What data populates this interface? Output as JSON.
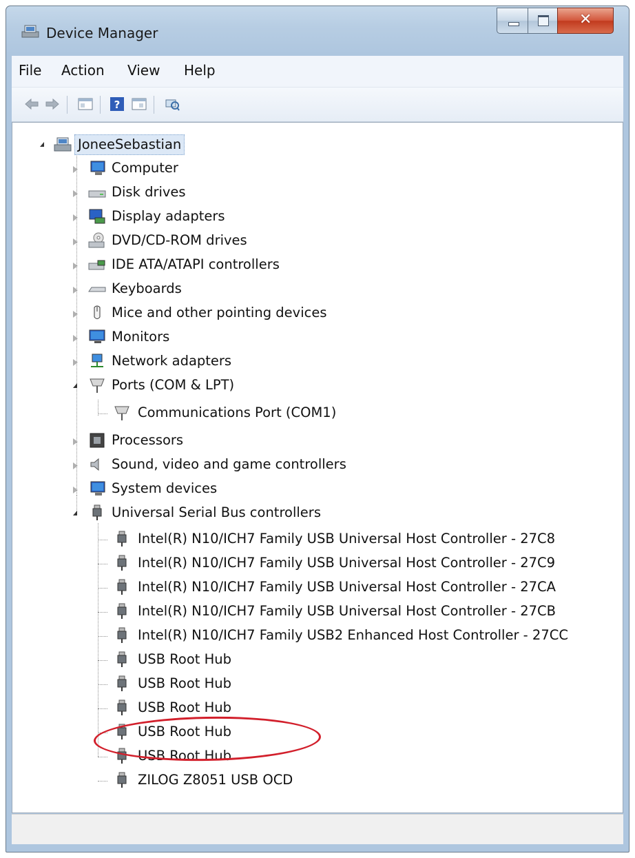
{
  "window": {
    "title": "Device Manager"
  },
  "menu": [
    "File",
    "Action",
    "View",
    "Help"
  ],
  "toolbar": [
    "back-icon",
    "forward-icon",
    "properties-icon",
    "help-icon",
    "view-icon",
    "scan-hardware-icon"
  ],
  "tree": {
    "root": "JoneeSebastian",
    "categories": [
      {
        "label": "Computer",
        "icon": "computer-icon",
        "expanded": false
      },
      {
        "label": "Disk drives",
        "icon": "disk-drive-icon",
        "expanded": false
      },
      {
        "label": "Display adapters",
        "icon": "display-adapter-icon",
        "expanded": false
      },
      {
        "label": "DVD/CD-ROM drives",
        "icon": "dvd-drive-icon",
        "expanded": false
      },
      {
        "label": "IDE ATA/ATAPI controllers",
        "icon": "ide-controller-icon",
        "expanded": false
      },
      {
        "label": "Keyboards",
        "icon": "keyboard-icon",
        "expanded": false
      },
      {
        "label": "Mice and other pointing devices",
        "icon": "mouse-icon",
        "expanded": false
      },
      {
        "label": "Monitors",
        "icon": "monitor-icon",
        "expanded": false
      },
      {
        "label": "Network adapters",
        "icon": "network-adapter-icon",
        "expanded": false
      },
      {
        "label": "Ports (COM & LPT)",
        "icon": "port-icon",
        "expanded": true,
        "children": [
          "Communications Port (COM1)"
        ]
      },
      {
        "label": "Processors",
        "icon": "processor-icon",
        "expanded": false
      },
      {
        "label": "Sound, video and game controllers",
        "icon": "speaker-icon",
        "expanded": false
      },
      {
        "label": "System devices",
        "icon": "system-device-icon",
        "expanded": false
      },
      {
        "label": "Universal Serial Bus controllers",
        "icon": "usb-icon",
        "expanded": true,
        "children": [
          "Intel(R) N10/ICH7 Family USB Universal Host Controller - 27C8",
          "Intel(R) N10/ICH7 Family USB Universal Host Controller - 27C9",
          "Intel(R) N10/ICH7 Family USB Universal Host Controller - 27CA",
          "Intel(R) N10/ICH7 Family USB Universal Host Controller - 27CB",
          "Intel(R) N10/ICH7 Family USB2 Enhanced Host Controller - 27CC",
          "USB Root Hub",
          "USB Root Hub",
          "USB Root Hub",
          "USB Root Hub",
          "USB Root Hub",
          "ZILOG Z8051 USB OCD"
        ]
      }
    ]
  },
  "colors": {
    "highlight_oval": "#d21f2b",
    "selection": "#dce8f6"
  }
}
